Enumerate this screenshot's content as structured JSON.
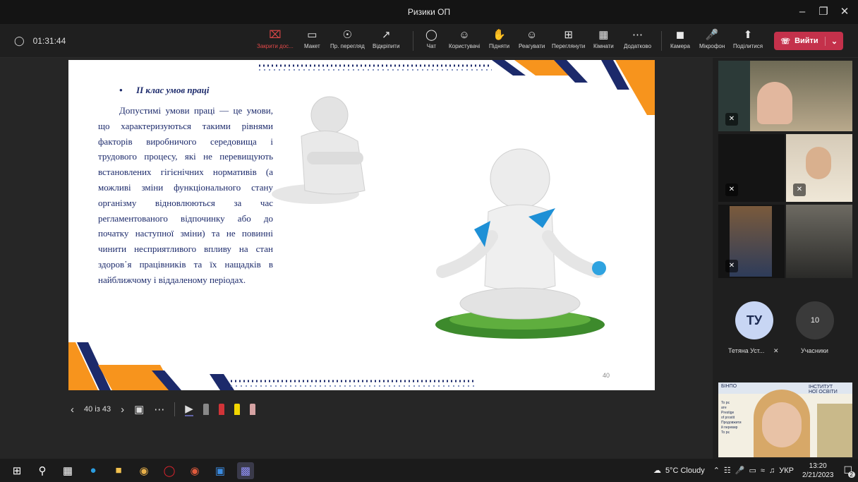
{
  "window": {
    "title": "Ризики ОП"
  },
  "meeting": {
    "elapsed": "01:31:44"
  },
  "toolbar": {
    "items": [
      {
        "label": "Закрити дос...",
        "icon": "close-share-icon"
      },
      {
        "label": "Макет",
        "icon": "layout-icon"
      },
      {
        "label": "Пр. перегляд",
        "icon": "preview-icon"
      },
      {
        "label": "Відкріпити",
        "icon": "popout-icon"
      },
      {
        "label": "Чат",
        "icon": "chat-icon"
      },
      {
        "label": "Користувачі",
        "icon": "people-icon"
      },
      {
        "label": "Підняти",
        "icon": "raise-hand-icon"
      },
      {
        "label": "Реагувати",
        "icon": "react-icon"
      },
      {
        "label": "Переглянути",
        "icon": "view-icon"
      },
      {
        "label": "Кімнати",
        "icon": "rooms-icon"
      },
      {
        "label": "Додатково",
        "icon": "more-icon"
      },
      {
        "label": "Камера",
        "icon": "camera-icon"
      },
      {
        "label": "Мікрофон",
        "icon": "mic-icon"
      },
      {
        "label": "Поділитися",
        "icon": "share-icon"
      }
    ],
    "leave_label": "Вийти",
    "leave_color": "#c4314b"
  },
  "slide": {
    "bullet": "ІІ клас умов праці",
    "body": "Допустимі умови праці — це умови, що характеризуються такими рівнями факторів виробничого середовища і трудового процесу, які не перевищують встановлених гігієнічних нормативів (а можливі зміни функціонального стану організму відновлюються за час регламентованого відпочинку або до початку наступної зміни) та не повинні чинити несприятливого впливу на стан здоров᾽я працівників та їх нащадків в найближчому і віддаленому періодах.",
    "page_number": "40",
    "accent_orange": "#f7941d",
    "accent_navy": "#1c2a6b"
  },
  "slide_nav": {
    "position": "40 із 43"
  },
  "participants": {
    "tetiana": {
      "initials": "ТУ",
      "name": "Тетяна Уст..."
    },
    "count": {
      "value": "10",
      "label": "Учасники"
    }
  },
  "presenter_video": {
    "logo": "БІНПО",
    "heading": "ІНСТИТУТ\nНОЇ ОСВІТИ",
    "notes": [
      "To рє",
      "ате",
      "Prestige",
      "of prostit",
      "Продовжити",
      "й перевир",
      "To рє"
    ]
  },
  "taskbar": {
    "weather": "5°C Cloudy",
    "lang": "УКР",
    "time": "13:20",
    "date": "2/21/2023",
    "notifications": "2"
  }
}
